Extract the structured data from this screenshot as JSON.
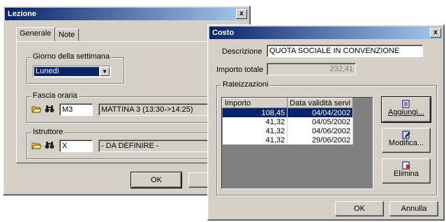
{
  "lezione": {
    "title": "Lezione",
    "close": "x",
    "tabs": [
      "Generale",
      "Note"
    ],
    "giorno": {
      "label": "Giorno della settimana",
      "value": "Lunedì"
    },
    "fascia": {
      "label": "Fascia oraria",
      "code": "M3",
      "desc": "MATTINA 3 (13:30->14:25)"
    },
    "istruttore": {
      "label": "Istruttore",
      "code": "X",
      "desc": "- DA DEFINIRE -"
    },
    "ok": "OK",
    "annulla_partial": "An"
  },
  "costo": {
    "title": "Costo",
    "close": "x",
    "descrizione_label": "Descrizione",
    "descrizione_value": "QUOTA SOCIALE IN CONVENZIONE",
    "importo_label": "Importo totale",
    "importo_value": "232,41",
    "rateizzazioni_label": "Rateizzazioni",
    "columns": [
      "Importo",
      "Data validità servi"
    ],
    "rows": [
      {
        "importo": "108,45",
        "data": "04/04/2002"
      },
      {
        "importo": "41,32",
        "data": "04/05/2002"
      },
      {
        "importo": "41,32",
        "data": "04/06/2002"
      },
      {
        "importo": "41,32",
        "data": "29/06/2002"
      }
    ],
    "aggiungi": "Aggiungi...",
    "modifica": "Modifica...",
    "elimina": "Elimina",
    "ok": "OK",
    "annulla": "Annulla"
  }
}
